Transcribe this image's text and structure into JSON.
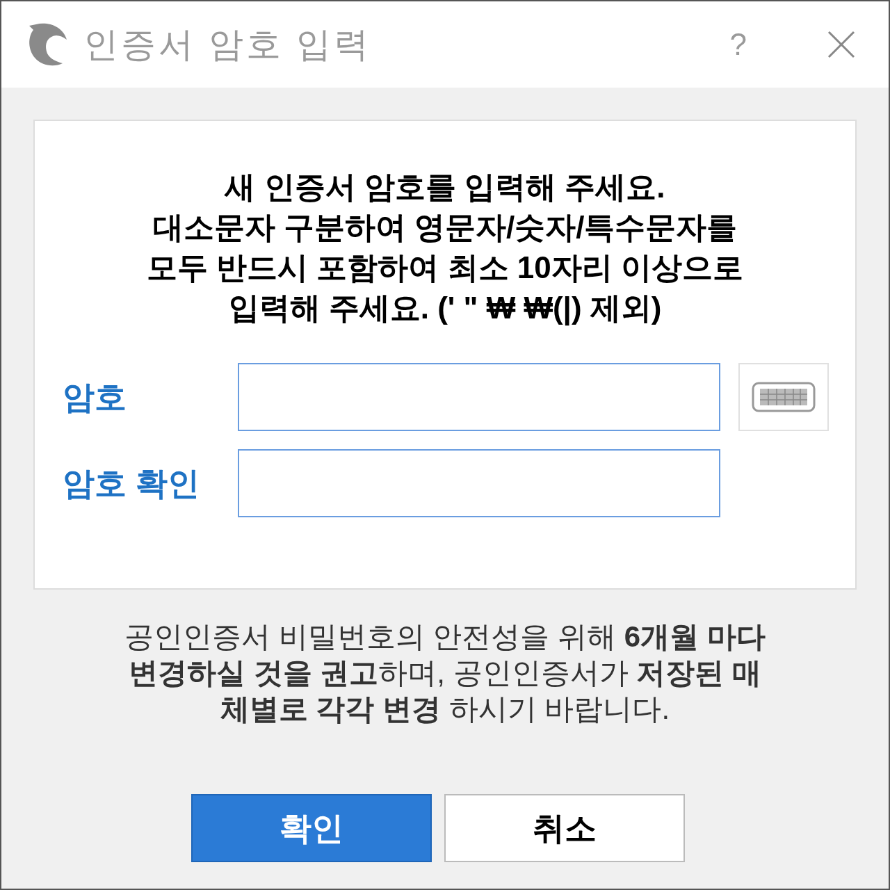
{
  "window": {
    "title": "인증서 암호 입력",
    "help": "?"
  },
  "instruction_lines": [
    "새 인증서 암호를 입력해 주세요.",
    "대소문자 구분하여 영문자/숫자/특수문자를",
    "모두 반드시 포함하여 최소 10자리 이상으로",
    "입력해 주세요. (' \" ₩ ₩(|) 제외)"
  ],
  "fields": [
    {
      "label": "암호",
      "keyboard": true
    },
    {
      "label": "암호 확인",
      "keyboard": false
    }
  ],
  "notice_lines": [
    "공인인증서 비밀번호의 안전성을 위해 **6개월 마다**",
    "**변경하실 것을 권고**하며, 공인인증서가 **저장된 매**",
    "**체별로 각각 변경** 하시기 바랍니다."
  ],
  "buttons": [
    {
      "label": "확인",
      "kind": "primary"
    },
    {
      "label": "취소",
      "kind": "secondary"
    }
  ]
}
